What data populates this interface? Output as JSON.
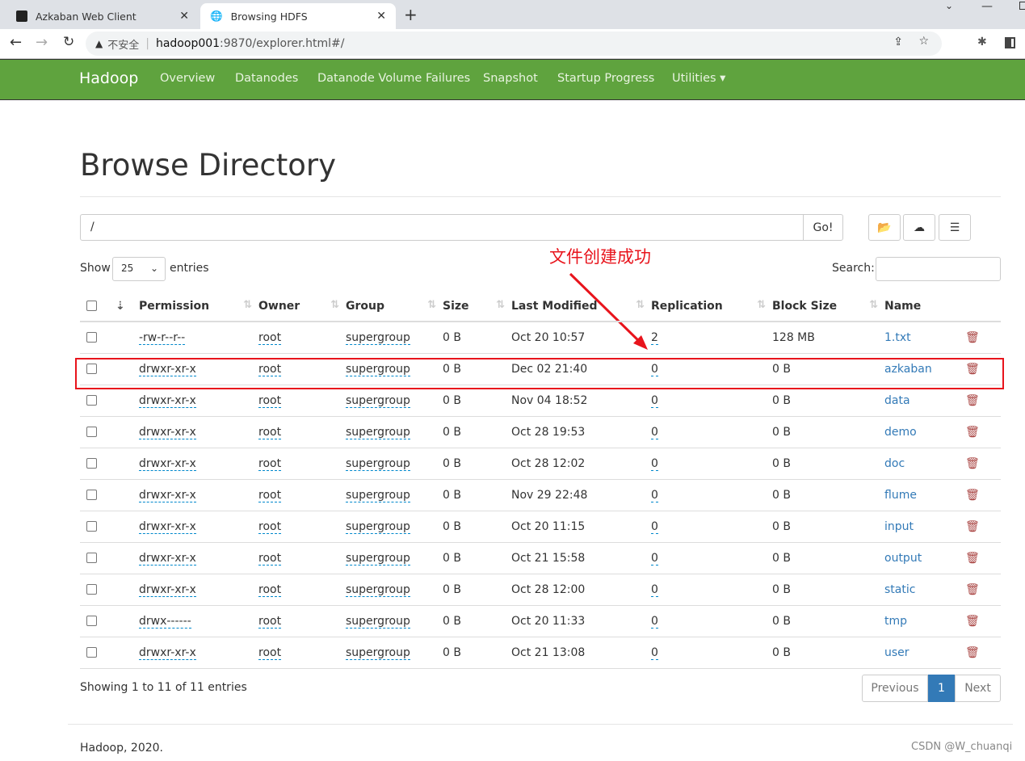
{
  "browser": {
    "tabs": [
      {
        "title": "Azkaban Web Client"
      },
      {
        "title": "Browsing HDFS"
      }
    ],
    "security": "不安全",
    "url_host": "hadoop001",
    "url_rest": ":9870/explorer.html#/"
  },
  "navbar": {
    "brand": "Hadoop",
    "items": [
      "Overview",
      "Datanodes",
      "Datanode Volume Failures",
      "Snapshot",
      "Startup Progress",
      "Utilities ▾"
    ],
    "color": "#5fa33e"
  },
  "page": {
    "title": "Browse Directory",
    "path": "/",
    "go": "Go!",
    "show": "Show",
    "entries_value": "25",
    "entries": "entries",
    "search": "Search:",
    "annotation": "文件创建成功",
    "showing": "Showing 1 to 11 of 11 entries",
    "prev": "Previous",
    "page": "1",
    "next": "Next",
    "footer": "Hadoop, 2020.",
    "watermark": "CSDN @W_chuanqi"
  },
  "table": {
    "headers": [
      "Permission",
      "Owner",
      "Group",
      "Size",
      "Last Modified",
      "Replication",
      "Block Size",
      "Name"
    ],
    "rows": [
      [
        "-rw-r--r--",
        "root",
        "supergroup",
        "0 B",
        "Oct 20 10:57",
        "2",
        "128 MB",
        "1.txt"
      ],
      [
        "drwxr-xr-x",
        "root",
        "supergroup",
        "0 B",
        "Dec 02 21:40",
        "0",
        "0 B",
        "azkaban"
      ],
      [
        "drwxr-xr-x",
        "root",
        "supergroup",
        "0 B",
        "Nov 04 18:52",
        "0",
        "0 B",
        "data"
      ],
      [
        "drwxr-xr-x",
        "root",
        "supergroup",
        "0 B",
        "Oct 28 19:53",
        "0",
        "0 B",
        "demo"
      ],
      [
        "drwxr-xr-x",
        "root",
        "supergroup",
        "0 B",
        "Oct 28 12:02",
        "0",
        "0 B",
        "doc"
      ],
      [
        "drwxr-xr-x",
        "root",
        "supergroup",
        "0 B",
        "Nov 29 22:48",
        "0",
        "0 B",
        "flume"
      ],
      [
        "drwxr-xr-x",
        "root",
        "supergroup",
        "0 B",
        "Oct 20 11:15",
        "0",
        "0 B",
        "input"
      ],
      [
        "drwxr-xr-x",
        "root",
        "supergroup",
        "0 B",
        "Oct 21 15:58",
        "0",
        "0 B",
        "output"
      ],
      [
        "drwxr-xr-x",
        "root",
        "supergroup",
        "0 B",
        "Oct 28 12:00",
        "0",
        "0 B",
        "static"
      ],
      [
        "drwx------",
        "root",
        "supergroup",
        "0 B",
        "Oct 20 11:33",
        "0",
        "0 B",
        "tmp"
      ],
      [
        "drwxr-xr-x",
        "root",
        "supergroup",
        "0 B",
        "Oct 21 13:08",
        "0",
        "0 B",
        "user"
      ]
    ],
    "highlight_row": 1
  }
}
